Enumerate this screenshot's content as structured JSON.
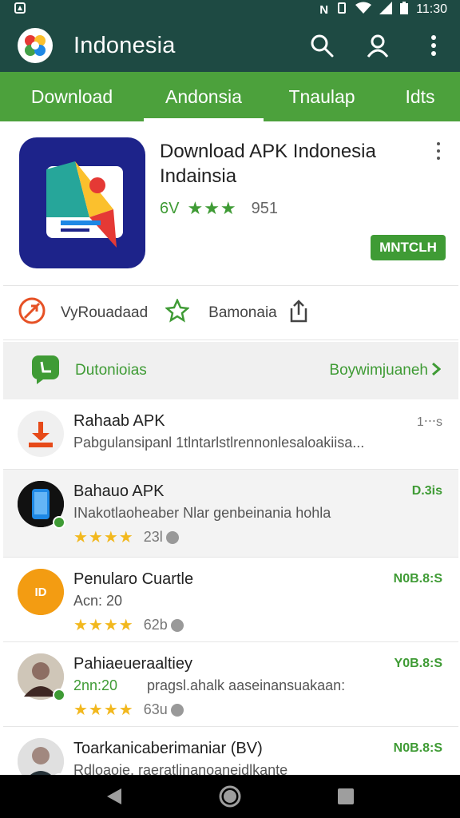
{
  "status_bar": {
    "time": "11:30"
  },
  "app_bar": {
    "title": "Indonesia"
  },
  "tabs": [
    {
      "label": "Download",
      "active": false
    },
    {
      "label": "Andonsia",
      "active": true
    },
    {
      "label": "Tnaulap",
      "active": false
    },
    {
      "label": "Idts",
      "active": false
    }
  ],
  "app_card": {
    "title_line1": "Download APK Indonesia",
    "title_line2": "Indainsia",
    "score": "6V",
    "stars": "★★★",
    "count": "951",
    "install_label": "MNTCLH"
  },
  "actions": {
    "download_label": "VyRouadaad",
    "share_label": "Bamonaia"
  },
  "section": {
    "title": "Dutonioias",
    "more": "Boywimjuaneh"
  },
  "list": [
    {
      "name": "Rahaab APK",
      "desc": "Pabgulansipanl 1tlntarlstlrennonlesaloakiisa...",
      "meta": "1‧‧‧s",
      "stars": "",
      "count": ""
    },
    {
      "name": "Bahauo APK",
      "desc": "INakotlaoheaber Nlar genbeinania hohla",
      "meta": "D.3is",
      "stars": "★★★★",
      "count": "23l"
    },
    {
      "name": "Penularo Cuartle",
      "desc": "Acn: 20",
      "meta": "N0B.8:S",
      "stars": "★★★★",
      "count": "62b"
    },
    {
      "name": "Pahiaeueraaltiey",
      "desc": "2nn:20",
      "desc2": "pragsl.ahalk aaseinansuakaan:",
      "meta": "Y0B.8:S",
      "stars": "★★★★",
      "count": "63u"
    },
    {
      "name": "Toarkanicaberimaniar (BV)",
      "desc": "Rdloaoie, raeratlinanoaneidlkante",
      "meta": "N0B.8:S",
      "stars": "",
      "count": ""
    }
  ],
  "colors": {
    "appbar": "#1e4a43",
    "tabs": "#4ca13c",
    "accent": "#3f9b35",
    "star": "#f2b81e"
  }
}
